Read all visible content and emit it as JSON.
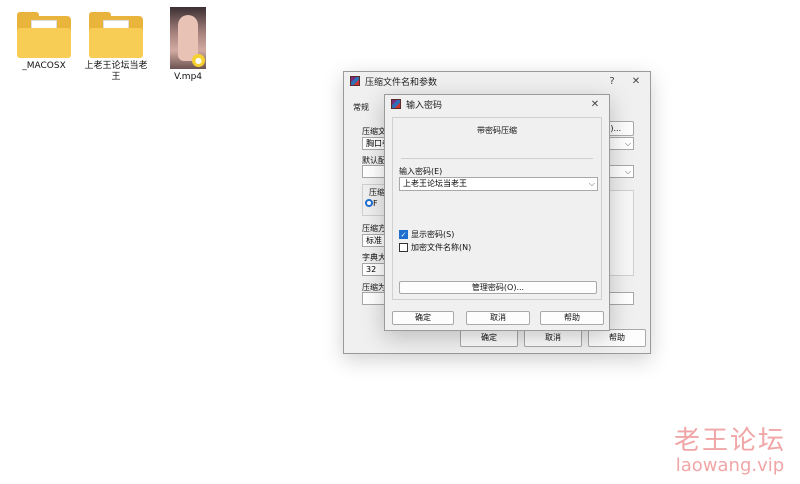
{
  "desktop": {
    "icons": [
      {
        "label": "_MACOSX"
      },
      {
        "label": "上老王论坛当老王"
      },
      {
        "label": "V.mp4"
      }
    ]
  },
  "compress_dialog": {
    "title": "压缩文件名和参数",
    "help_glyph": "?",
    "close_glyph": "✕",
    "tab_general": "常规",
    "archive_name_label": "压缩文",
    "archive_name_value": "胸口養",
    "browse_button": "B)...",
    "default_config_label": "默认配",
    "format_group_label": "压缩文",
    "format_radio_label": "F",
    "method_label": "压缩方",
    "method_value": "标准",
    "dict_label": "字典大",
    "dict_value": "32",
    "split_label": "压缩为",
    "ok_button": "确定",
    "cancel_button": "取消",
    "help_button": "帮助"
  },
  "password_dialog": {
    "title": "输入密码",
    "close_glyph": "✕",
    "heading": "带密码压缩",
    "input_label": "输入密码(E)",
    "input_value": "上老王论坛当老王",
    "show_password_label": "显示密码(S)",
    "encrypt_names_label": "加密文件名称(N)",
    "show_password_checked": true,
    "encrypt_names_checked": false,
    "manage_button": "管理密码(O)...",
    "ok_button": "确定",
    "cancel_button": "取消",
    "help_button": "帮助"
  },
  "watermark": {
    "cn": "老王论坛",
    "en": "laowang.vip"
  }
}
